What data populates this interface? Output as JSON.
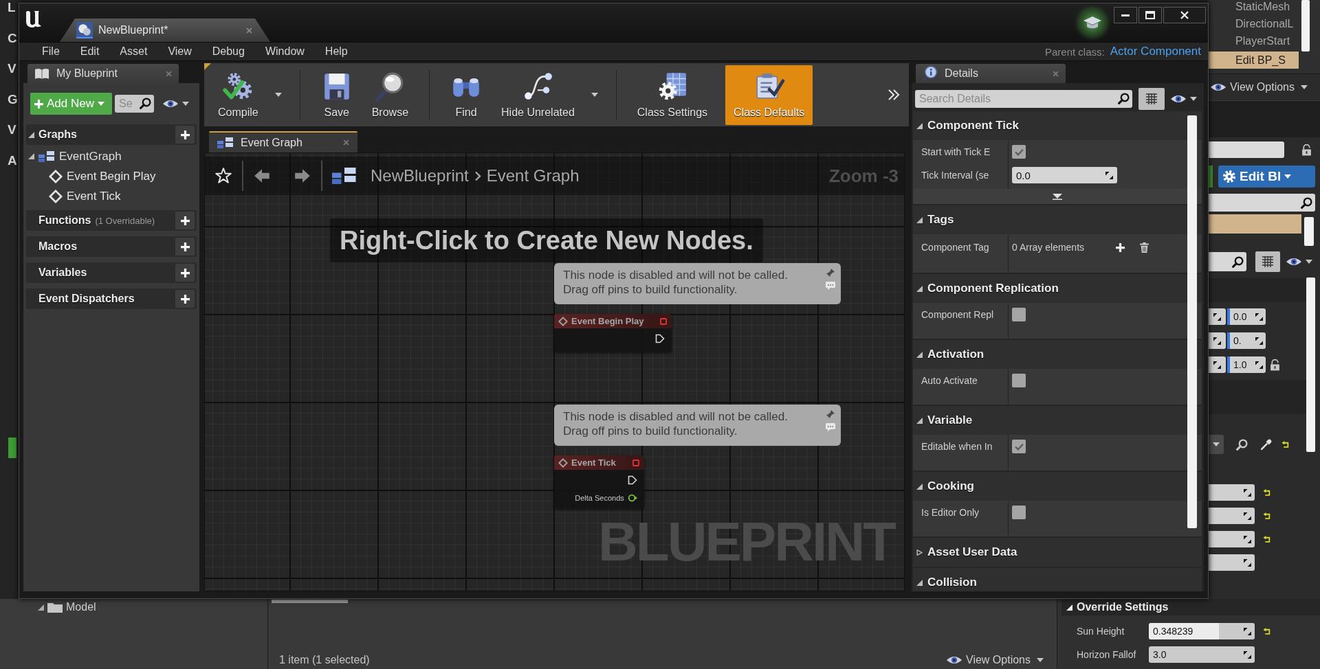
{
  "background": {
    "side_letters": [
      "L",
      "C",
      "V",
      "G",
      "V",
      "A"
    ],
    "outliner": {
      "items": [
        {
          "label": "StaticMesh",
          "selected": false
        },
        {
          "label": "DirectionalL",
          "selected": false
        },
        {
          "label": "PlayerStart",
          "selected": false
        },
        {
          "label": "Edit BP_S",
          "selected": true
        }
      ],
      "view_options": "View Options"
    },
    "details": {
      "edit_button": "Edit Bl",
      "transform_values": [
        "0.0",
        "0.",
        "1.0"
      ],
      "section": "Override Settings",
      "properties": [
        {
          "label": "Sun Height",
          "value": "0.348239",
          "level": 0.66,
          "modified": true
        },
        {
          "label": "Horizon Fallof",
          "value": "3.0",
          "modified": false
        }
      ]
    },
    "content_browser": {
      "tree_item": "Model",
      "status": "1 item (1 selected)",
      "view_options": "View Options"
    }
  },
  "window": {
    "tab": "NewBlueprint*",
    "menu": [
      "File",
      "Edit",
      "Asset",
      "View",
      "Debug",
      "Window",
      "Help"
    ],
    "parent_class": {
      "label": "Parent class:",
      "value": "Actor Component"
    }
  },
  "my_blueprint": {
    "tab": "My Blueprint",
    "add_button": "Add New",
    "search": {
      "placeholder": "Se"
    },
    "sections": [
      {
        "label": "Graphs",
        "children": [
          {
            "label": "EventGraph",
            "kind": "graph",
            "children": [
              {
                "label": "Event Begin Play",
                "kind": "event"
              },
              {
                "label": "Event Tick",
                "kind": "event"
              }
            ]
          }
        ]
      },
      {
        "label": "Functions",
        "note": "(1 Overridable)"
      },
      {
        "label": "Macros"
      },
      {
        "label": "Variables"
      },
      {
        "label": "Event Dispatchers"
      }
    ]
  },
  "toolbar": {
    "groups": [
      [
        {
          "kind": "compile",
          "label": "Compile",
          "dropdown": true,
          "selected": false
        }
      ],
      [
        {
          "kind": "save",
          "label": "Save",
          "dropdown": false,
          "selected": false
        },
        {
          "kind": "browse",
          "label": "Browse",
          "dropdown": false,
          "selected": false
        }
      ],
      [
        {
          "kind": "find",
          "label": "Find",
          "dropdown": false,
          "selected": false
        },
        {
          "kind": "hide_unrelated",
          "label": "Hide Unrelated",
          "dropdown": true,
          "selected": false
        }
      ],
      [
        {
          "kind": "class_settings",
          "label": "Class Settings",
          "dropdown": false,
          "selected": false
        },
        {
          "kind": "class_defaults",
          "label": "Class Defaults",
          "dropdown": false,
          "selected": true
        }
      ]
    ]
  },
  "graph": {
    "tab": "Event Graph",
    "breadcrumb": [
      "NewBlueprint",
      "Event Graph"
    ],
    "zoom": "Zoom -3",
    "hint": "Right-Click to Create New Nodes.",
    "nodes": [
      {
        "title": "Event Begin Play",
        "disabled": true,
        "comment_lines": [
          "This node is disabled and will not be called.",
          "Drag off pins to build functionality."
        ],
        "pins": [
          {
            "kind": "exec"
          }
        ]
      },
      {
        "title": "Event Tick",
        "disabled": true,
        "comment_lines": [
          "This node is disabled and will not be called.",
          "Drag off pins to build functionality."
        ],
        "pins": [
          {
            "kind": "exec"
          },
          {
            "kind": "float",
            "label": "Delta Seconds"
          }
        ]
      }
    ],
    "watermark": "BLUEPRINT"
  },
  "details": {
    "tab": "Details",
    "search": {
      "placeholder": "Search Details"
    },
    "sections": [
      {
        "title": "Component Tick",
        "expanded": true,
        "advanced": true,
        "rows": [
          {
            "kind": "checkbox",
            "label": "Start with Tick E",
            "checked": true
          },
          {
            "kind": "number",
            "label": "Tick Interval (se",
            "value": "0.0"
          }
        ]
      },
      {
        "title": "Tags",
        "expanded": true,
        "rows": [
          {
            "kind": "array",
            "label": "Component Tag",
            "value": "0 Array elements"
          }
        ]
      },
      {
        "title": "Component Replication",
        "expanded": true,
        "rows": [
          {
            "kind": "checkbox",
            "label": "Component Repl",
            "checked": false
          }
        ]
      },
      {
        "title": "Activation",
        "expanded": true,
        "rows": [
          {
            "kind": "checkbox",
            "label": "Auto Activate",
            "checked": false
          }
        ]
      },
      {
        "title": "Variable",
        "expanded": true,
        "rows": [
          {
            "kind": "checkbox",
            "label": "Editable when In",
            "checked": true
          }
        ]
      },
      {
        "title": "Cooking",
        "expanded": true,
        "rows": [
          {
            "kind": "checkbox",
            "label": "Is Editor Only",
            "checked": false
          }
        ]
      },
      {
        "title": "Asset User Data",
        "expanded": false
      },
      {
        "title": "Collision",
        "expanded": true
      }
    ]
  }
}
